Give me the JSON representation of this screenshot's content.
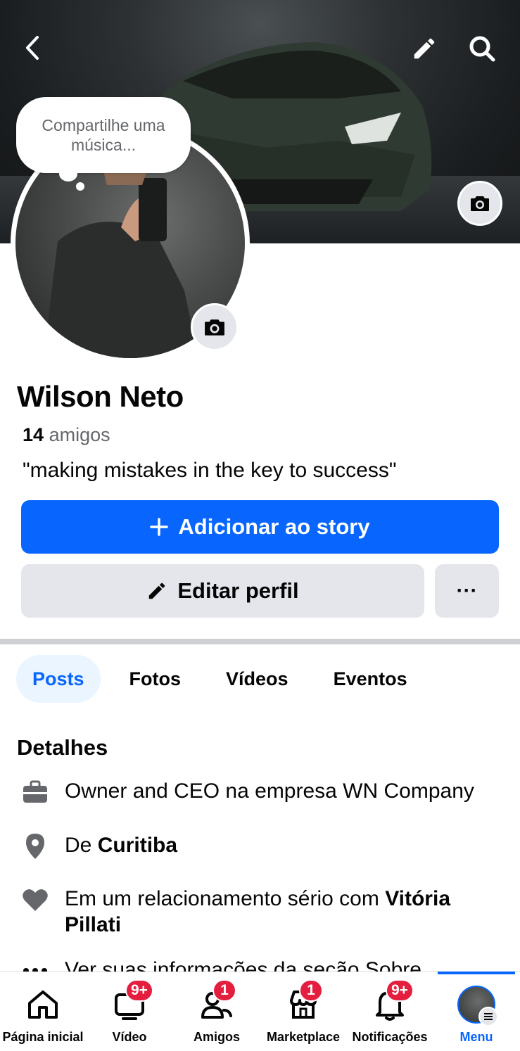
{
  "cover": {
    "colors": {
      "accent": "#0866ff"
    },
    "icons": {
      "back": "chevron-left-icon",
      "edit": "pencil-icon",
      "search": "search-icon",
      "camera": "camera-icon"
    }
  },
  "bubble": {
    "text": "Compartilhe uma música..."
  },
  "profile": {
    "name": "Wilson Neto",
    "friends_count": "14",
    "friends_label": "amigos",
    "bio": "\"making mistakes in the key to success\""
  },
  "actions": {
    "story_label": "Adicionar ao story",
    "edit_label": "Editar perfil",
    "more_label": "···"
  },
  "tabs": [
    {
      "label": "Posts",
      "active": true
    },
    {
      "label": "Fotos"
    },
    {
      "label": "Vídeos"
    },
    {
      "label": "Eventos"
    }
  ],
  "details": {
    "title": "Detalhes",
    "work": "Owner and CEO na empresa WN Company",
    "location_prefix": "De",
    "location_city": "Curitiba",
    "relationship_prefix": "Em um relacionamento sério com",
    "relationship_partner": "Vitória Pillati",
    "about_partial": "Ver suas informações da seção Sobre"
  },
  "nav": [
    {
      "label": "Página inicial",
      "icon": "home-icon"
    },
    {
      "label": "Vídeo",
      "icon": "video-icon",
      "badge": "9+"
    },
    {
      "label": "Amigos",
      "icon": "friends-icon",
      "badge": "1"
    },
    {
      "label": "Marketplace",
      "icon": "marketplace-icon",
      "badge": "1"
    },
    {
      "label": "Notificações",
      "icon": "bell-icon",
      "badge": "9+"
    },
    {
      "label": "Menu",
      "icon": "menu-avatar-icon",
      "active": true
    }
  ]
}
